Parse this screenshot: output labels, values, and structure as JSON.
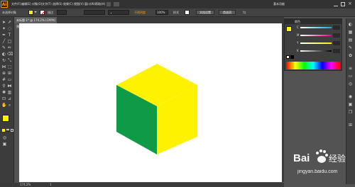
{
  "app": {
    "logo": "Ai",
    "workspace": "基本功能"
  },
  "menus": [
    "文件(F)",
    "编辑(E)",
    "对象(O)",
    "文字(T)",
    "选择(S)",
    "效果(C)",
    "视图(V)",
    "窗口(W)",
    "帮助(H)"
  ],
  "control": {
    "selection_label": "未选择对象",
    "stroke_label": "描边",
    "stroke_value": "",
    "opacity_label": "不透明度",
    "opacity_value": "100%",
    "style_label": "样式",
    "doc_setup": "文档设置",
    "preferences": "首选项"
  },
  "document": {
    "tab_title": "未标题-1* @ 174.2% (CMYK/预览)"
  },
  "color_panel": {
    "title": "颜色",
    "channels": [
      {
        "label": "C",
        "value": ""
      },
      {
        "label": "M",
        "value": ""
      },
      {
        "label": "Y",
        "value": ""
      },
      {
        "label": "K",
        "value": ""
      }
    ]
  },
  "status": {
    "zoom": "174.2%",
    "page": "1"
  },
  "watermark": {
    "brand": "Bai",
    "brand2": "经验",
    "url": "jingyan.baidu.com"
  },
  "colors": {
    "fill": "#fff200",
    "cube_top": "#fff200",
    "cube_right": "#fff200",
    "cube_left": "#0f9a48",
    "accent": "#ff9a00"
  }
}
